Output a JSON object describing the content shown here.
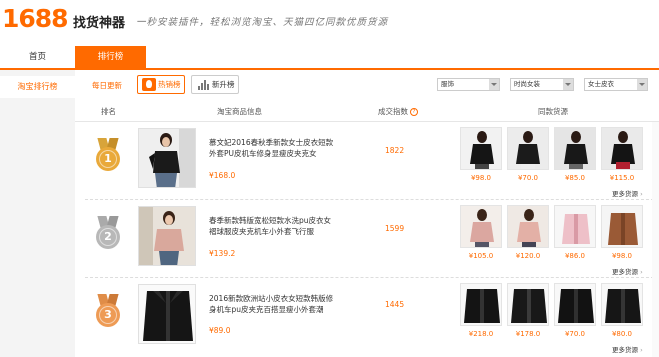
{
  "header": {
    "logo_num": "1688",
    "logo_text": "找货神器",
    "slogan": "一秒安装插件，轻松浏览淘宝、天猫四亿同款优质货源"
  },
  "nav": {
    "home": "首页",
    "rank": "排行榜"
  },
  "sidebar": {
    "item": "淘宝排行榜"
  },
  "toolbar": {
    "daily": "每日更新",
    "hot": "热销榜",
    "new": "新升榜",
    "filters": [
      "服饰",
      "时尚女装",
      "女士皮衣"
    ]
  },
  "columns": {
    "rank": "排名",
    "info": "淘宝商品信息",
    "count": "成交指数",
    "source": "同款货源"
  },
  "colors": {
    "accent": "#ff6a00",
    "gold": "#e9a93a",
    "silver": "#b8b8b8",
    "bronze": "#ee9b55"
  },
  "rows": [
    {
      "rank": "1",
      "title": "慕文妃2016春秋季新款女士皮衣短款外套PU皮机车修身显瘦皮夹克女",
      "price": "¥168.0",
      "count": "1822",
      "sources": [
        "¥98.0",
        "¥70.0",
        "¥85.0",
        "¥115.0"
      ],
      "more": "更多货源"
    },
    {
      "rank": "2",
      "title": "春季新款韩版宽松短款水洗pu皮衣女褶球服皮夹克机车小外套飞行服",
      "price": "¥139.2",
      "count": "1599",
      "sources": [
        "¥105.0",
        "¥120.0",
        "¥86.0",
        "¥98.0"
      ],
      "more": "更多货源"
    },
    {
      "rank": "3",
      "title": "2016新款欧洲站小皮衣女短款韩版修身机车pu皮夹克百搭显瘦小外套潮",
      "price": "¥89.0",
      "count": "1445",
      "sources": [
        "¥218.0",
        "¥178.0",
        "¥70.0",
        "¥80.0"
      ],
      "more": "更多货源"
    }
  ]
}
